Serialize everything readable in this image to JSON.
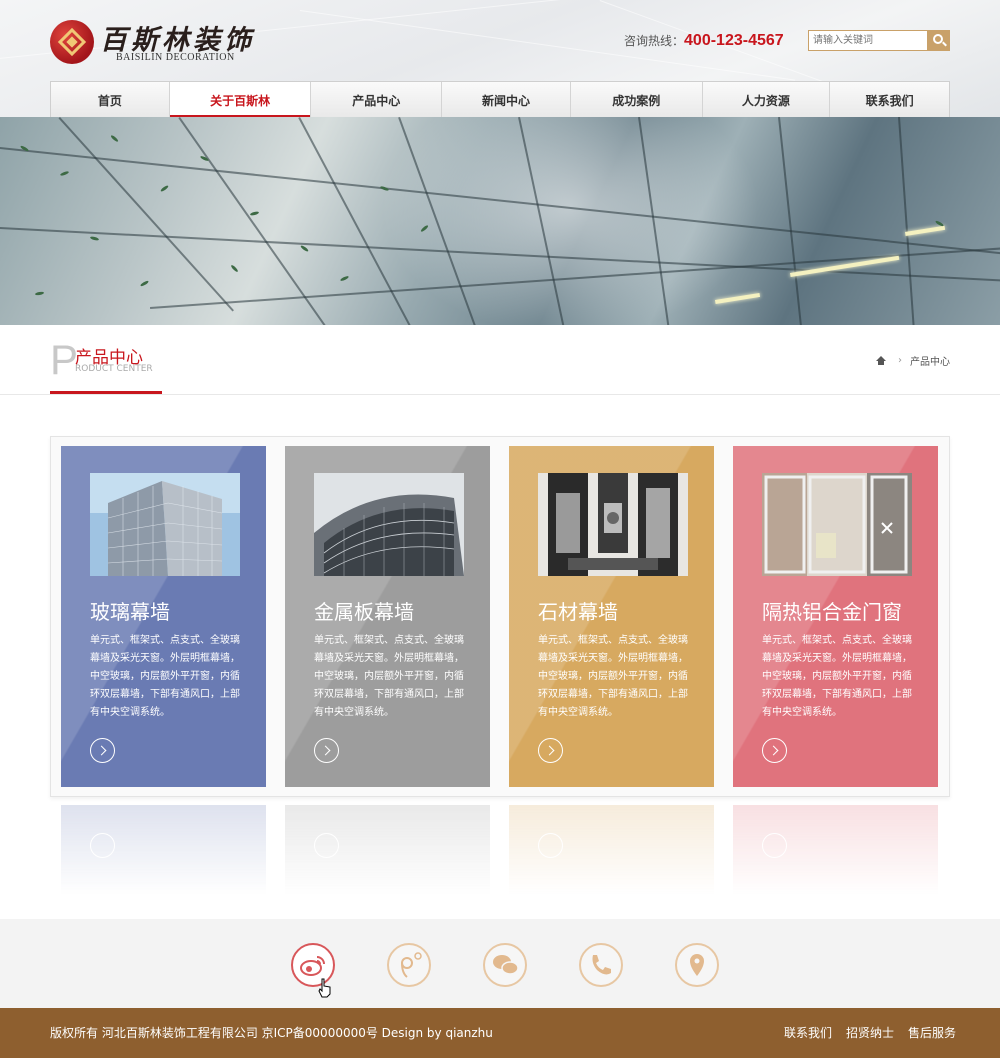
{
  "header": {
    "logo_cn": "百斯林装饰",
    "logo_en": "BAISILIN DECORATION",
    "hotline_label": "咨询热线：",
    "hotline_number": "400-123-4567",
    "search_placeholder": "请输入关键词"
  },
  "nav": {
    "items": [
      {
        "label": "首页"
      },
      {
        "label": "关于百斯林",
        "active": true
      },
      {
        "label": "产品中心"
      },
      {
        "label": "新闻中心"
      },
      {
        "label": "成功案例"
      },
      {
        "label": "人力资源"
      },
      {
        "label": "联系我们"
      }
    ]
  },
  "section": {
    "letter": "P",
    "title_cn": "产品中心",
    "title_en": "RODUCT CENTER",
    "breadcrumb_sep": "›",
    "breadcrumb_current": "产品中心"
  },
  "cards": [
    {
      "title": "玻璃幕墙",
      "desc": "单元式、框架式、点支式、全玻璃幕墙及采光天窗。外层明框幕墙，中空玻璃，内层额外平开窗，内循环双层幕墙，下部有通风口，上部有中央空调系统。",
      "color": "#6a7bb3",
      "icon": "arrow-right-icon"
    },
    {
      "title": "金属板幕墙",
      "desc": "单元式、框架式、点支式、全玻璃幕墙及采光天窗。外层明框幕墙，中空玻璃，内层额外平开窗，内循环双层幕墙，下部有通风口，上部有中央空调系统。",
      "color": "#9d9d9d",
      "icon": "arrow-right-icon"
    },
    {
      "title": "石材幕墙",
      "desc": "单元式、框架式、点支式、全玻璃幕墙及采光天窗。外层明框幕墙，中空玻璃，内层额外平开窗，内循环双层幕墙，下部有通风口，上部有中央空调系统。",
      "color": "#d7a960",
      "icon": "arrow-right-icon"
    },
    {
      "title": "隔热铝合金门窗",
      "desc": "单元式、框架式、点支式、全玻璃幕墙及采光天窗。外层明框幕墙，中空玻璃，内层额外平开窗，内循环双层幕墙，下部有通风口，上部有中央空调系统。",
      "color": "#e0737d",
      "icon": "arrow-right-icon"
    }
  ],
  "social_icons": [
    "weibo-icon",
    "tencent-weibo-icon",
    "wechat-icon",
    "phone-icon",
    "location-icon"
  ],
  "footer": {
    "copyright": "版权所有  河北百斯林装饰工程有限公司  京ICP备00000000号  Design by qianzhu",
    "links": [
      "联系我们",
      "招贤纳士",
      "售后服务"
    ]
  },
  "colors": {
    "accent": "#c8161d",
    "footer_bg": "#8e5f2f",
    "icon_ring": "#e7c7a3"
  }
}
